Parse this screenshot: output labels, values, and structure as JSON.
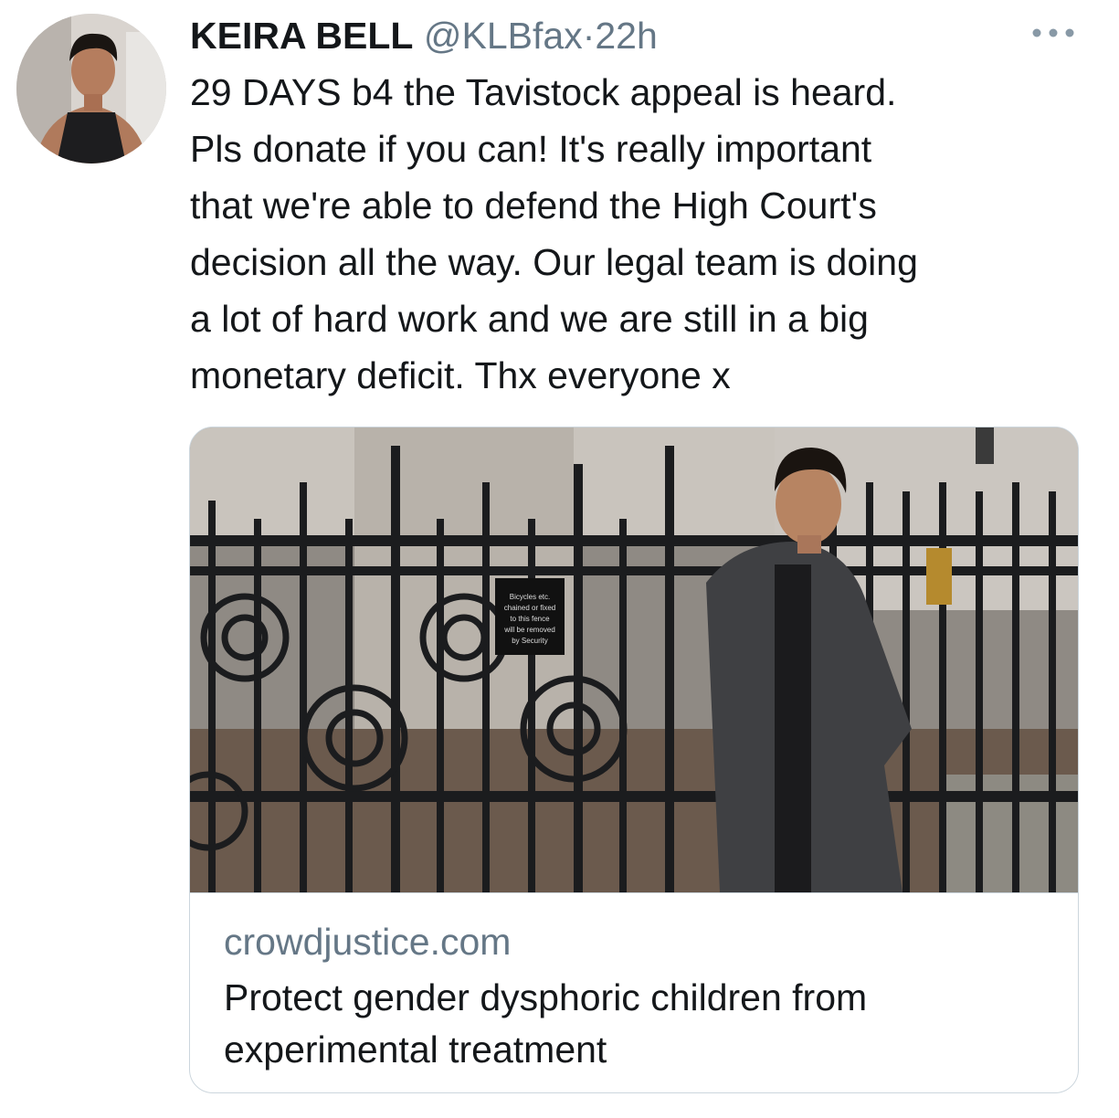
{
  "tweet": {
    "author_name": "KEIRA BELL",
    "handle": "@KLBfax",
    "separator": "·",
    "time": "22h",
    "text": "29 DAYS b4 the Tavistock appeal is heard.\nPls donate if you can! It's really important\nthat we're able to defend the High Court's\ndecision all the way. Our legal team is doing\na lot of hard work and we are still in a big\nmonetary deficit. Thx everyone x",
    "avatar_icon": "profile-photo",
    "more_icon": "more-options-icon"
  },
  "card": {
    "domain": "crowdjustice.com",
    "title": "Protect gender dysphoric children from experimental treatment",
    "photo_sign_text": "Bicycles etc. chained or fixed to this fence will be removed by Security"
  },
  "colors": {
    "text_primary": "#14171a",
    "text_secondary": "#657786",
    "border": "#ccd6dd"
  }
}
